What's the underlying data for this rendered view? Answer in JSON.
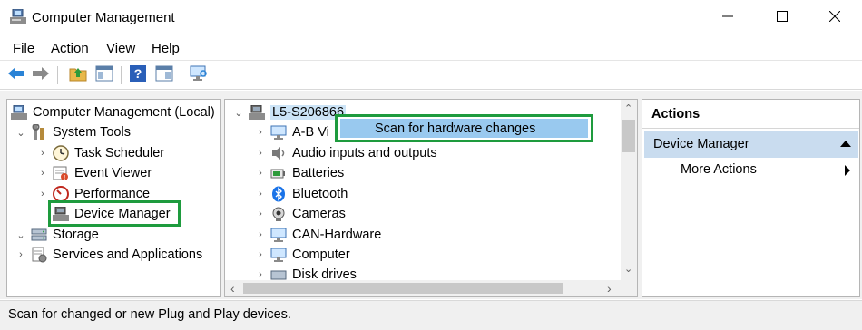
{
  "window": {
    "title": "Computer Management",
    "controls": {
      "minimize": "minimize-icon",
      "maximize": "maximize-icon",
      "close": "close-icon"
    }
  },
  "menu": [
    "File",
    "Action",
    "View",
    "Help"
  ],
  "toolbar": {
    "buttons": [
      "back-arrow-icon",
      "forward-arrow-icon",
      "up-folder-icon",
      "show-hide-tree-icon",
      "help-icon",
      "properties-icon",
      "scan-hardware-icon"
    ]
  },
  "tree": {
    "root": "Computer Management (Local)",
    "system_tools": "System Tools",
    "task_scheduler": "Task Scheduler",
    "event_viewer": "Event Viewer",
    "performance": "Performance",
    "device_manager": "Device Manager",
    "storage": "Storage",
    "services": "Services and Applications"
  },
  "devices": {
    "computer_name": "L5-S206866",
    "items": [
      "A-B Vi",
      "Audio inputs and outputs",
      "Batteries",
      "Bluetooth",
      "Cameras",
      "CAN-Hardware",
      "Computer",
      "Disk drives"
    ]
  },
  "context_menu": {
    "item": "Scan for hardware changes"
  },
  "actions": {
    "header": "Actions",
    "group": "Device Manager",
    "more": "More Actions"
  },
  "status": {
    "text": "Scan for changed or new Plug and Play devices."
  },
  "colors": {
    "highlight_border": "#1e9b3e",
    "menu_selection": "#99c9ef",
    "actions_group": "#c9dcef"
  }
}
